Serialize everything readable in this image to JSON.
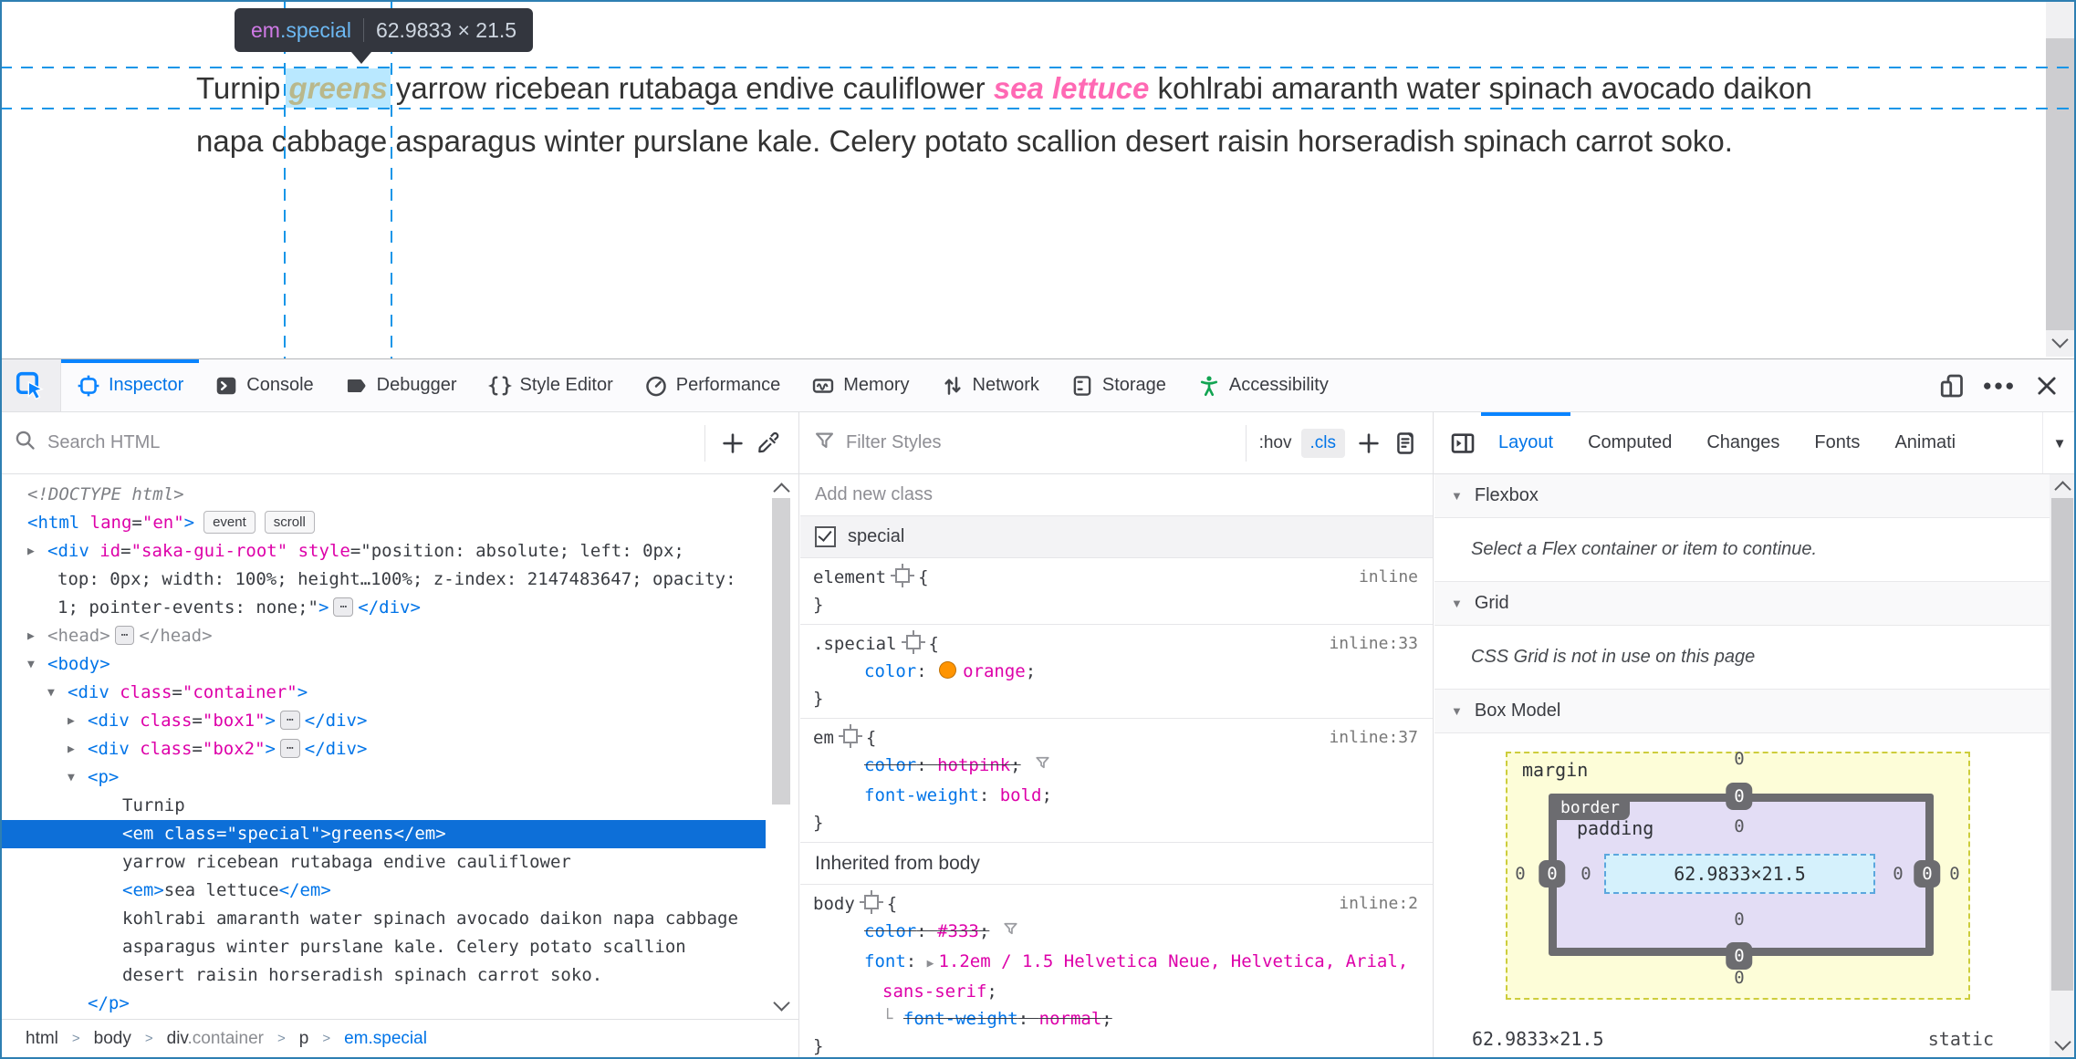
{
  "page": {
    "tooltip": {
      "tag": "em",
      "class": ".special",
      "dimensions": "62.9833 × 21.5"
    },
    "paragraph": {
      "before": "Turnip ",
      "special_text": "greens",
      "middle": " yarrow ricebean rutabaga endive cauliflower ",
      "em_text": "sea lettuce",
      "after": " kohlrabi amaranth water spinach avocado daikon napa cabbage asparagus winter purslane kale. Celery potato scallion desert raisin horseradish spinach carrot soko.",
      "special_color": "#ff9400",
      "em_color": "#ff69b4",
      "text_color": "#333333",
      "highlight_color": "rgba(128,214,255,0.55)",
      "guide_color": "#1796e8"
    }
  },
  "toolbar": {
    "accent": "#0a84ff",
    "tabs": [
      {
        "id": "inspector",
        "label": "Inspector",
        "active": true
      },
      {
        "id": "console",
        "label": "Console"
      },
      {
        "id": "debugger",
        "label": "Debugger"
      },
      {
        "id": "styleeditor",
        "label": "Style Editor"
      },
      {
        "id": "performance",
        "label": "Performance"
      },
      {
        "id": "memory",
        "label": "Memory"
      },
      {
        "id": "network",
        "label": "Network"
      },
      {
        "id": "storage",
        "label": "Storage"
      },
      {
        "id": "accessibility",
        "label": "Accessibility",
        "icon_color": "#12a452"
      }
    ]
  },
  "markup_panel": {
    "search_placeholder": "Search HTML",
    "tree": [
      {
        "ind": 30,
        "tk": [
          [
            "i",
            "<!DOCTYPE html>"
          ]
        ]
      },
      {
        "ind": 30,
        "tk": [
          [
            "t",
            "<html"
          ],
          [
            "d",
            " "
          ],
          [
            "a",
            "lang"
          ],
          [
            "d",
            "="
          ],
          [
            "v",
            "\"en\""
          ],
          [
            "t",
            ">"
          ],
          [
            "b",
            "event"
          ],
          [
            "b",
            "scroll"
          ]
        ]
      },
      {
        "ind": 52,
        "exp": 30,
        "open": false,
        "tk": [
          [
            "t",
            "<div"
          ],
          [
            "d",
            " "
          ],
          [
            "a",
            "id"
          ],
          [
            "d",
            "="
          ],
          [
            "v",
            "\"saka-gui-root\""
          ],
          [
            "d",
            " "
          ],
          [
            "a",
            "style"
          ],
          [
            "d",
            "=\"position: absolute; left: 0px;"
          ]
        ]
      },
      {
        "ind": 63,
        "tk": [
          [
            "d",
            "top: 0px; width: 100%; height…100%; z-index: 2147483647; opacity:"
          ]
        ]
      },
      {
        "ind": 63,
        "tk": [
          [
            "d",
            "1; pointer-events: none;\""
          ],
          [
            "t",
            ">"
          ],
          [
            "e",
            "⋯"
          ],
          [
            "t",
            "</div>"
          ]
        ]
      },
      {
        "ind": 52,
        "exp": 30,
        "open": false,
        "tk": [
          [
            "g",
            "<head>"
          ],
          [
            "e",
            "⋯"
          ],
          [
            "g",
            "</head>"
          ]
        ]
      },
      {
        "ind": 52,
        "exp": 30,
        "open": true,
        "tk": [
          [
            "t",
            "<body>"
          ]
        ]
      },
      {
        "ind": 74,
        "exp": 52,
        "open": true,
        "tk": [
          [
            "t",
            "<div"
          ],
          [
            "d",
            " "
          ],
          [
            "a",
            "class"
          ],
          [
            "d",
            "="
          ],
          [
            "v",
            "\"container\""
          ],
          [
            "t",
            ">"
          ]
        ]
      },
      {
        "ind": 96,
        "exp": 74,
        "open": false,
        "tk": [
          [
            "t",
            "<div"
          ],
          [
            "d",
            " "
          ],
          [
            "a",
            "class"
          ],
          [
            "d",
            "="
          ],
          [
            "v",
            "\"box1\""
          ],
          [
            "t",
            ">"
          ],
          [
            "e",
            "⋯"
          ],
          [
            "t",
            "</div>"
          ]
        ]
      },
      {
        "ind": 96,
        "exp": 74,
        "open": false,
        "tk": [
          [
            "t",
            "<div"
          ],
          [
            "d",
            " "
          ],
          [
            "a",
            "class"
          ],
          [
            "d",
            "="
          ],
          [
            "v",
            "\"box2\""
          ],
          [
            "t",
            ">"
          ],
          [
            "e",
            "⋯"
          ],
          [
            "t",
            "</div>"
          ]
        ]
      },
      {
        "ind": 96,
        "exp": 74,
        "open": true,
        "tk": [
          [
            "t",
            "<p>"
          ]
        ]
      },
      {
        "ind": 134,
        "tk": [
          [
            "d",
            "Turnip"
          ]
        ]
      },
      {
        "ind": 134,
        "sel": true,
        "tk": [
          [
            "t",
            "<em"
          ],
          [
            "d",
            " "
          ],
          [
            "a",
            "class"
          ],
          [
            "d",
            "="
          ],
          [
            "v",
            "\"special\""
          ],
          [
            "t",
            ">"
          ],
          [
            "d",
            "greens"
          ],
          [
            "t",
            "</em>"
          ]
        ]
      },
      {
        "ind": 134,
        "tk": [
          [
            "d",
            "yarrow ricebean rutabaga endive cauliflower"
          ]
        ]
      },
      {
        "ind": 134,
        "tk": [
          [
            "t",
            "<em>"
          ],
          [
            "d",
            "sea lettuce"
          ],
          [
            "t",
            "</em>"
          ]
        ]
      },
      {
        "ind": 134,
        "tk": [
          [
            "d",
            "kohlrabi amaranth water spinach avocado daikon napa cabbage"
          ]
        ]
      },
      {
        "ind": 134,
        "tk": [
          [
            "d",
            "asparagus winter purslane kale. Celery potato scallion"
          ]
        ]
      },
      {
        "ind": 134,
        "tk": [
          [
            "d",
            "desert raisin horseradish spinach carrot soko."
          ]
        ]
      },
      {
        "ind": 96,
        "tk": [
          [
            "t",
            "</p>"
          ]
        ]
      }
    ],
    "breadcrumb": [
      {
        "label": "html",
        "style": "plain"
      },
      {
        "label": "body",
        "style": "plain"
      },
      {
        "label": "div",
        "muted_suffix": ".container",
        "style": "plain"
      },
      {
        "label": "p",
        "style": "plain"
      },
      {
        "label": "em.special",
        "style": "selected"
      }
    ]
  },
  "rules_panel": {
    "filter_placeholder": "Filter Styles",
    "pseudo_button": ":hov",
    "class_button": ".cls",
    "add_class_placeholder": "Add new class",
    "class_toggle": {
      "name": "special",
      "checked": true
    },
    "inherited_header": "Inherited from body",
    "rules": [
      {
        "selector": "element",
        "location": "inline",
        "declarations": []
      },
      {
        "selector": ".special",
        "location": "inline:33",
        "declarations": [
          {
            "name": "color",
            "value": "orange",
            "swatch": "#ff9400"
          }
        ]
      },
      {
        "selector": "em",
        "location": "inline:37",
        "declarations": [
          {
            "name": "color",
            "value": "hotpink",
            "struck": true,
            "filter_icon": true
          },
          {
            "name": "font-weight",
            "value": "bold"
          }
        ]
      },
      {
        "selector": "body",
        "location": "inline:2",
        "inherited": true,
        "declarations": [
          {
            "name": "color",
            "value": "#333",
            "struck": true,
            "filter_icon": true
          },
          {
            "name": "font",
            "value": "1.2em / 1.5 Helvetica Neue, Helvetica, Arial, sans-serif",
            "expand_arrow": true
          },
          {
            "name": "font-weight",
            "value": "normal",
            "struck": true,
            "nested": true
          }
        ]
      }
    ]
  },
  "sidebar_panel": {
    "tabs": [
      {
        "label": "Layout",
        "active": true
      },
      {
        "label": "Computed"
      },
      {
        "label": "Changes"
      },
      {
        "label": "Fonts"
      },
      {
        "label": "Animati"
      }
    ],
    "flexbox": {
      "title": "Flexbox",
      "message": "Select a Flex container or item to continue."
    },
    "grid": {
      "title": "Grid",
      "message": "CSS Grid is not in use on this page"
    },
    "box_model": {
      "title": "Box Model",
      "margin_label": "margin",
      "border_label": "border",
      "padding_label": "padding",
      "content": "62.9833×21.5",
      "margin": {
        "top": "0",
        "right": "0",
        "bottom": "0",
        "left": "0"
      },
      "border": {
        "top": "0",
        "right": "0",
        "bottom": "0",
        "left": "0"
      },
      "padding": {
        "top": "0",
        "right": "0",
        "bottom": "0",
        "left": "0"
      },
      "footer_dimensions": "62.9833×21.5",
      "footer_position": "static",
      "colors": {
        "margin_bg": "#fdfdd8",
        "border_bg": "#6c6c70",
        "padding_bg": "#e3ddf5",
        "content_bg": "#d5f1fc"
      }
    }
  }
}
